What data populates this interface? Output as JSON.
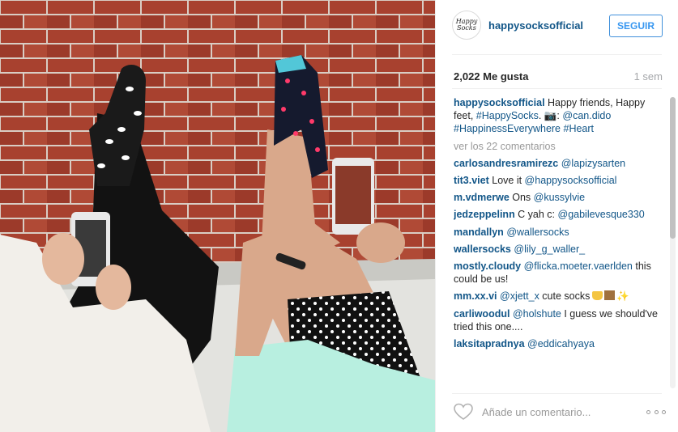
{
  "post": {
    "username": "happysocksofficial",
    "follow_label": "SEGUIR",
    "likes": "2,022 Me gusta",
    "age": "1 sem",
    "avatar_mark": "Happy Socks",
    "caption": {
      "user": "happysocksofficial",
      "text_1": " Happy friends, Happy feet, ",
      "tag_1": "#HappySocks",
      "text_2": ". 📷: ",
      "mention": "@can.dido",
      "text_3": " ",
      "tag_2": "#HappinessEverywhere",
      "text_4": " ",
      "tag_3": "#Heart"
    },
    "view_comments": "ver los 22 comentarios",
    "comments": [
      {
        "user": "carlosandresramirezc",
        "text": " ",
        "mention": "@lapizysarten",
        "after": ""
      },
      {
        "user": "tit3.viet",
        "text": " Love it ",
        "mention": "@happysocksofficial",
        "after": ""
      },
      {
        "user": "m.vdmerwe",
        "text": " Ons ",
        "mention": "@kussylvie",
        "after": ""
      },
      {
        "user": "jedzeppelinn",
        "text": " C yah c: ",
        "mention": "@gabilevesque330",
        "after": ""
      },
      {
        "user": "mandallyn",
        "text": " ",
        "mention": "@wallersocks",
        "after": ""
      },
      {
        "user": "wallersocks",
        "text": " ",
        "mention": "@lily_g_waller_",
        "after": ""
      },
      {
        "user": "mostly.cloudy",
        "text": " ",
        "mention": "@flicka.moeter.vaerlden",
        "after": " this could be us!"
      },
      {
        "user": "mm.xx.vi",
        "text": " ",
        "mention": "@xjett_x",
        "after": " cute socks"
      },
      {
        "user": "carliwoodul",
        "text": " ",
        "mention": "@holshute",
        "after": " I guess we should've tried this one...."
      },
      {
        "user": "laksitapradnya",
        "text": " ",
        "mention": "@eddicahyaya",
        "after": ""
      }
    ],
    "comment_placeholder": "Añade un comentario...",
    "icons": {
      "heart": "heart-outline-icon",
      "options": "ellipsis-icon",
      "camera": "camera-emoji",
      "hands": "raised-hands-emoji",
      "skin_tone": "skin-tone-emoji",
      "sparkles": "sparkles-emoji"
    },
    "colors": {
      "link": "#125688",
      "follow": "#3897f0",
      "muted": "#999999"
    }
  }
}
